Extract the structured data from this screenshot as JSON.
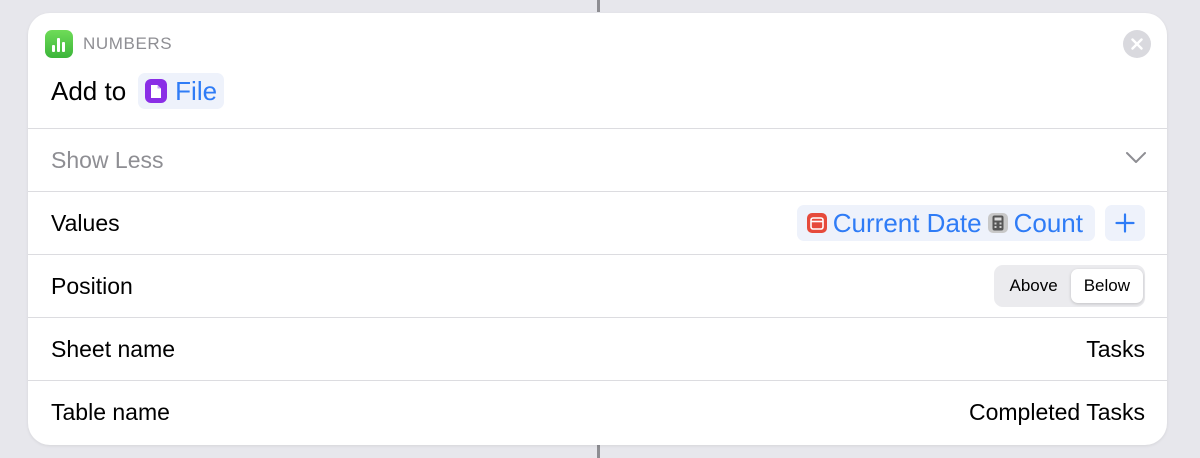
{
  "action": {
    "app_name": "NUMBERS",
    "title_prefix": "Add to",
    "file_token": "File"
  },
  "show_less": {
    "label": "Show Less"
  },
  "values": {
    "label": "Values",
    "variables": [
      "Current Date",
      "Count"
    ]
  },
  "position": {
    "label": "Position",
    "options": [
      "Above",
      "Below"
    ],
    "selected": "Below"
  },
  "sheet_name": {
    "label": "Sheet name",
    "value": "Tasks"
  },
  "table_name": {
    "label": "Table name",
    "value": "Completed Tasks"
  },
  "colors": {
    "token_blue": "#2f7cf6",
    "token_background": "#eef2fb",
    "app_icon_green": "#3cb53a",
    "file_icon_purple": "#8a2ee6",
    "calendar_icon_red": "#e64a3b"
  },
  "icons": {
    "app": "numbers-app-icon",
    "close": "close-icon",
    "file": "document-icon",
    "chevron": "chevron-down-icon",
    "calendar": "calendar-icon",
    "calculator": "calculator-icon",
    "add": "plus-icon"
  }
}
